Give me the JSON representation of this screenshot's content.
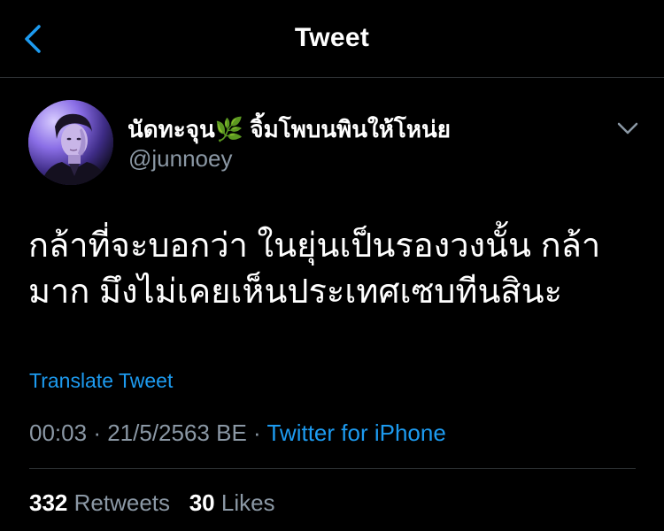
{
  "header": {
    "title": "Tweet"
  },
  "tweet": {
    "author": {
      "display_name": "นัดทะจุน🌿 จิ้มโพบนพินให้โหน่ย",
      "handle": "@junnoey"
    },
    "text_line1": "กล้าที่จะบอกว่า ในยุ่นเป็นรองวงนั้น กล้า",
    "text_line2": "มาก มึงไม่เคยเห็นประเทศเซบทีนสินะ",
    "translate_label": "Translate Tweet",
    "time": "00:03",
    "separator": "·",
    "date": "21/5/2563 BE",
    "source": "Twitter for iPhone",
    "retweets_count": "332",
    "retweets_label": "Retweets",
    "likes_count": "30",
    "likes_label": "Likes"
  },
  "icons": {
    "back": "chevron-left-icon",
    "more": "chevron-down-icon"
  },
  "colors": {
    "background": "#000000",
    "accent": "#1d9bf0",
    "secondary_text": "#8b98a5",
    "divider": "#2f3336"
  }
}
